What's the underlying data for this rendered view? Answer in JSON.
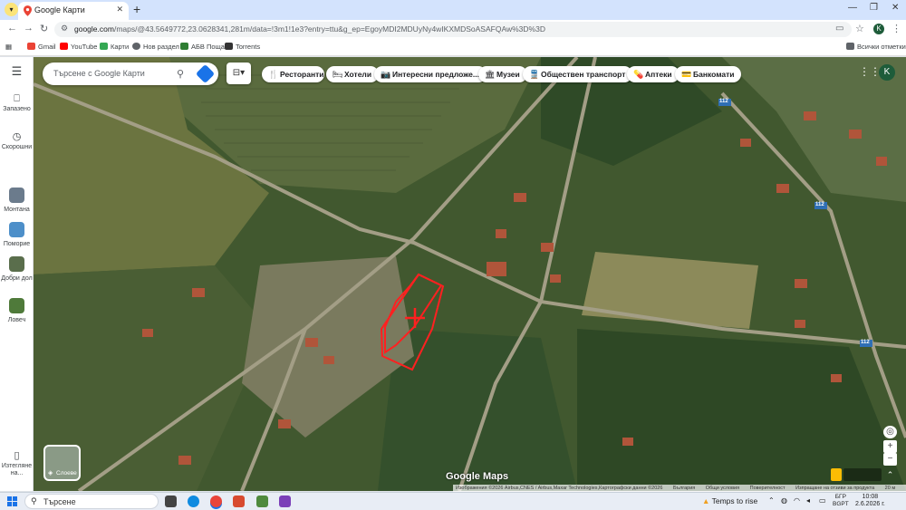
{
  "browser": {
    "tab_title": "Google Карти",
    "url_main": "google.com",
    "url_rest": "/maps/@43.5649772,23.0628341,281m/data=!3m1!1e3?entry=ttu&g_ep=EgoyMDI2MDUyNy4wIKXMDSoASAFQAw%3D%3D",
    "profile_initial": "K"
  },
  "bookmarks": {
    "items": [
      {
        "label": "Gmail",
        "color": "#ea4335"
      },
      {
        "label": "YouTube",
        "color": "#ff0000"
      },
      {
        "label": "Карти",
        "color": "#34a853"
      },
      {
        "label": "Нов раздел",
        "color": "#5f6368"
      },
      {
        "label": "АБВ Поща",
        "color": "#2e7d32"
      },
      {
        "label": "Torrents",
        "color": "#333333"
      }
    ],
    "all_bookmarks": "Всички отметки"
  },
  "rail": {
    "saved": "Запазено",
    "recent": "Скорошни",
    "places": [
      {
        "label": "Монтана",
        "color": "#6b7b8c"
      },
      {
        "label": "Поморие",
        "color": "#4d8fc9"
      },
      {
        "label": "Добри дол",
        "color": "#5a6e4c"
      },
      {
        "label": "Ловеч",
        "color": "#4f7a3a"
      }
    ],
    "download": "Изтегляне на..."
  },
  "search": {
    "placeholder": "Търсене с Google Карти"
  },
  "chips": [
    {
      "label": "Ресторанти",
      "icon": "restaurant-icon",
      "glyph": "🍴"
    },
    {
      "label": "Хотели",
      "icon": "hotel-icon",
      "glyph": "🛏"
    },
    {
      "label": "Интересни предложе...",
      "icon": "camera-icon",
      "glyph": "📷"
    },
    {
      "label": "Музеи",
      "icon": "museum-icon",
      "glyph": "🏛"
    },
    {
      "label": "Обществен транспорт",
      "icon": "transit-icon",
      "glyph": "🚆"
    },
    {
      "label": "Аптеки",
      "icon": "pharmacy-icon",
      "glyph": "💊"
    },
    {
      "label": "Банкомати",
      "icon": "atm-icon",
      "glyph": "💳"
    }
  ],
  "map": {
    "layers_label": "Слоеве",
    "road_number": "112",
    "logo": "Google Maps",
    "attribution": [
      "Изображения ©2026 Airbus,CNES / Airbus,Maxar Technologies,Картографски данни ©2026",
      "България",
      "Общи условия",
      "Поверителност",
      "Изпращане на отзиви за продукта",
      "20 м"
    ]
  },
  "taskbar": {
    "search_label": "Търсене",
    "weather": "Temps to rise",
    "lang_top": "БГР",
    "lang_bottom": "BGPT",
    "time": "10:08",
    "date": "2.6.2026 г."
  }
}
